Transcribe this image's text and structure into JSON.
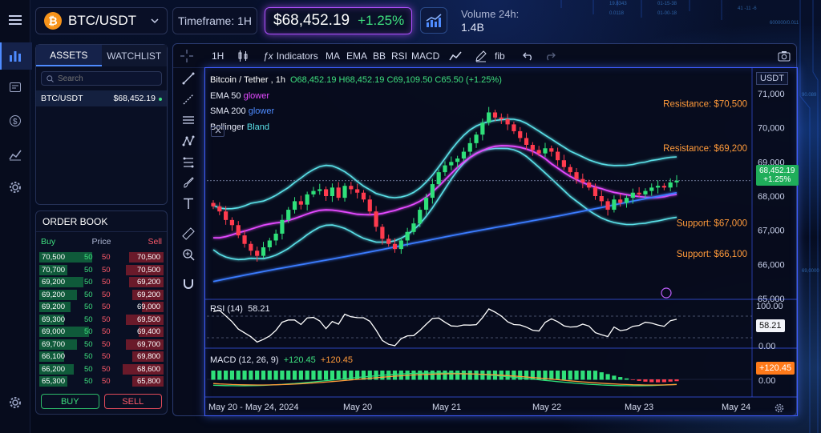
{
  "header": {
    "pair": "BTC/USDT",
    "coin_symbol": "₿",
    "timeframe": "Timeframe: 1H",
    "price": "$68,452.19",
    "change": "+1.25%",
    "volume_label": "Volume 24h:",
    "volume_value": "1.4B"
  },
  "assets": {
    "tabs": [
      "ASSETS",
      "WATCHLIST"
    ],
    "search_placeholder": "Search",
    "rows": [
      {
        "symbol": "BTC/USDT",
        "price": "$68,452.19"
      }
    ]
  },
  "orderbook": {
    "title": "ORDER BOOK",
    "headers": {
      "buy": "Buy",
      "price": "Price",
      "sell": "Sell"
    },
    "rows": [
      {
        "buy": "70,500",
        "b": "50",
        "s": "50",
        "sell": "70,500",
        "bw": 0.85,
        "sw": 0.55
      },
      {
        "buy": "70,700",
        "b": "50",
        "s": "50",
        "sell": "70,500",
        "bw": 0.45,
        "sw": 0.6
      },
      {
        "buy": "69,200",
        "b": "50",
        "s": "50",
        "sell": "69,200",
        "bw": 0.7,
        "sw": 0.55
      },
      {
        "buy": "69,200",
        "b": "50",
        "s": "50",
        "sell": "69,200",
        "bw": 0.6,
        "sw": 0.5
      },
      {
        "buy": "69,200",
        "b": "50",
        "s": "50",
        "sell": "69,000",
        "bw": 0.5,
        "sw": 0.35
      },
      {
        "buy": "69,300",
        "b": "50",
        "s": "50",
        "sell": "69,500",
        "bw": 0.4,
        "sw": 0.6
      },
      {
        "buy": "69,000",
        "b": "50",
        "s": "50",
        "sell": "69,400",
        "bw": 0.8,
        "sw": 0.4
      },
      {
        "buy": "69,700",
        "b": "50",
        "s": "50",
        "sell": "69,700",
        "bw": 0.6,
        "sw": 0.6
      },
      {
        "buy": "66,100",
        "b": "50",
        "s": "50",
        "sell": "69,800",
        "bw": 0.4,
        "sw": 0.5
      },
      {
        "buy": "66,200",
        "b": "50",
        "s": "50",
        "sell": "68,600",
        "bw": 0.55,
        "sw": 0.65
      },
      {
        "buy": "65,300",
        "b": "50",
        "s": "50",
        "sell": "65,800",
        "bw": 0.45,
        "sw": 0.5
      }
    ],
    "buy_button": "BUY",
    "sell_button": "SELL"
  },
  "toolbar": {
    "interval": "1H",
    "indicators": "Indicators",
    "items": [
      "MA",
      "EMA",
      "BB",
      "RSI",
      "MACD"
    ],
    "fib": "fib"
  },
  "legend": {
    "title": "Bitcoin / Tether , 1h",
    "ohlc": "O68,452.19  H68,452.19  C69,109.50  C65.50 (+1.25%)",
    "ema": "EMA 50",
    "ema_tag": "glower",
    "sma": "SMA 200",
    "sma_tag": "glower",
    "bb": "Bollinger",
    "bb_tag": "Bland"
  },
  "levels": {
    "r1": "Resistance: $70,500",
    "r2": "Resistance: $69,200",
    "s1": "Support: $67,000",
    "s2": "Support: $66,100"
  },
  "axis": {
    "currency": "USDT",
    "price_ticks": [
      "71,000",
      "70,000",
      "69,000",
      "68,000",
      "67,000",
      "66,000",
      "65,000"
    ],
    "current_price": "68,452.19",
    "current_change": "+1.25%",
    "rsi_ticks": [
      "100.00",
      "0.00"
    ],
    "rsi_value": "58.21",
    "macd_value": "+120.45",
    "macd_zero": "0.00",
    "x_ticks": [
      "May 20 - May 24, 2024",
      "May 20",
      "May 21",
      "May 22",
      "May 23",
      "May 24"
    ]
  },
  "rsi": {
    "label": "RSI (14)",
    "value": "58.21"
  },
  "macd": {
    "label": "MACD (12, 26, 9)",
    "v1": "+120.45",
    "v2": "+120.45"
  },
  "chart_data": {
    "type": "candlestick",
    "title": "Bitcoin / Tether , 1h",
    "y_range": [
      65000,
      71000
    ],
    "closes": [
      67700,
      67550,
      67300,
      67150,
      66850,
      66600,
      66400,
      66250,
      66500,
      66700,
      66900,
      67300,
      67600,
      67850,
      67750,
      68050,
      68150,
      68200,
      68000,
      68250,
      67950,
      68300,
      68200,
      68100,
      67900,
      67550,
      67100,
      66750,
      66600,
      66450,
      66700,
      66950,
      67200,
      67600,
      67950,
      68350,
      68700,
      68900,
      69000,
      69100,
      69300,
      69550,
      69800,
      70150,
      70450,
      70300,
      70250,
      70100,
      69900,
      69700,
      69500,
      69350,
      69250,
      69400,
      69300,
      69050,
      68850,
      68700,
      68500,
      68400,
      68250,
      68000,
      67850,
      67600,
      67900,
      67800,
      67950,
      68100,
      68050,
      68150,
      68250,
      68300,
      68250,
      68400,
      68452
    ],
    "levels": [
      70500,
      69200,
      67000,
      66100
    ],
    "rsi_value": 58.21,
    "macd_value": 120.45
  }
}
